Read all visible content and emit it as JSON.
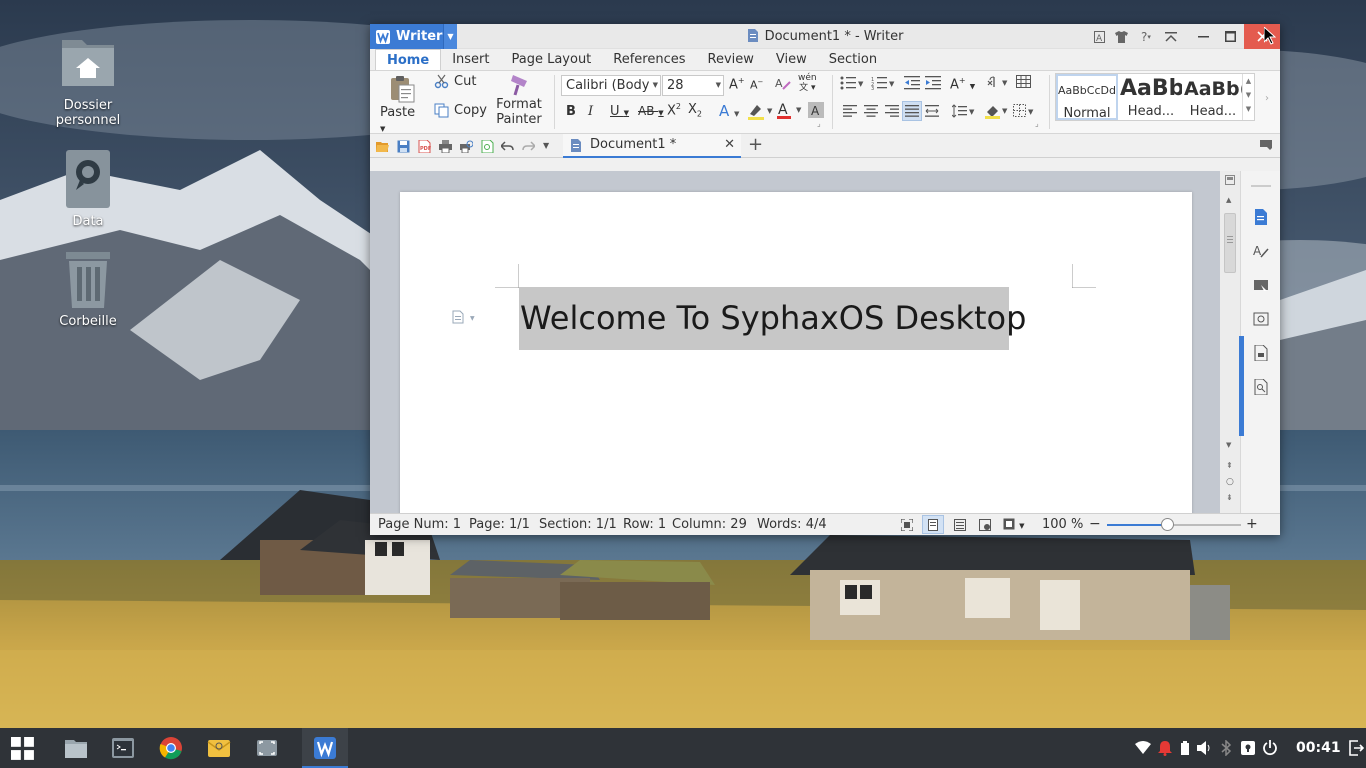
{
  "desktop": {
    "icons": [
      {
        "label": "Dossier personnel",
        "icon": "home-folder-icon"
      },
      {
        "label": "Data",
        "icon": "drive-icon"
      },
      {
        "label": "Corbeille",
        "icon": "trash-icon"
      }
    ]
  },
  "window": {
    "app_button": "Writer",
    "title": "Document1 * - Writer",
    "menu_tabs": [
      "Home",
      "Insert",
      "Page Layout",
      "References",
      "Review",
      "View",
      "Section"
    ],
    "active_tab": "Home",
    "ribbon": {
      "paste": "Paste",
      "cut": "Cut",
      "copy": "Copy",
      "format_painter_1": "Format",
      "format_painter_2": "Painter",
      "font_name": "Calibri (Body",
      "font_size": "28",
      "styles": [
        {
          "preview": "AaBbCcDd",
          "name": "Normal"
        },
        {
          "preview": "AaBb",
          "name": "Head..."
        },
        {
          "preview": "AaBb(",
          "name": "Head..."
        }
      ]
    },
    "doc_tab": "Document1 *",
    "document": {
      "text": "Welcome To SyphaxOS Desktop"
    },
    "status": {
      "page_num": "Page Num: 1",
      "page": "Page: 1/1",
      "section": "Section: 1/1",
      "row": "Row: 1",
      "column": "Column: 29",
      "words": "Words: 4/4",
      "zoom": "100 %",
      "zoom_value": 0.45
    }
  },
  "taskbar": {
    "clock": "00:41",
    "apps": [
      "apps-grid-icon",
      "file-manager-icon",
      "terminal-icon",
      "chrome-icon",
      "mail-icon",
      "screenshot-icon",
      "writer-icon"
    ]
  },
  "colors": {
    "accent": "#3b7bd4",
    "close": "#e45b4f",
    "selection": "#c7c7c7",
    "taskbar": "#2f3338"
  }
}
